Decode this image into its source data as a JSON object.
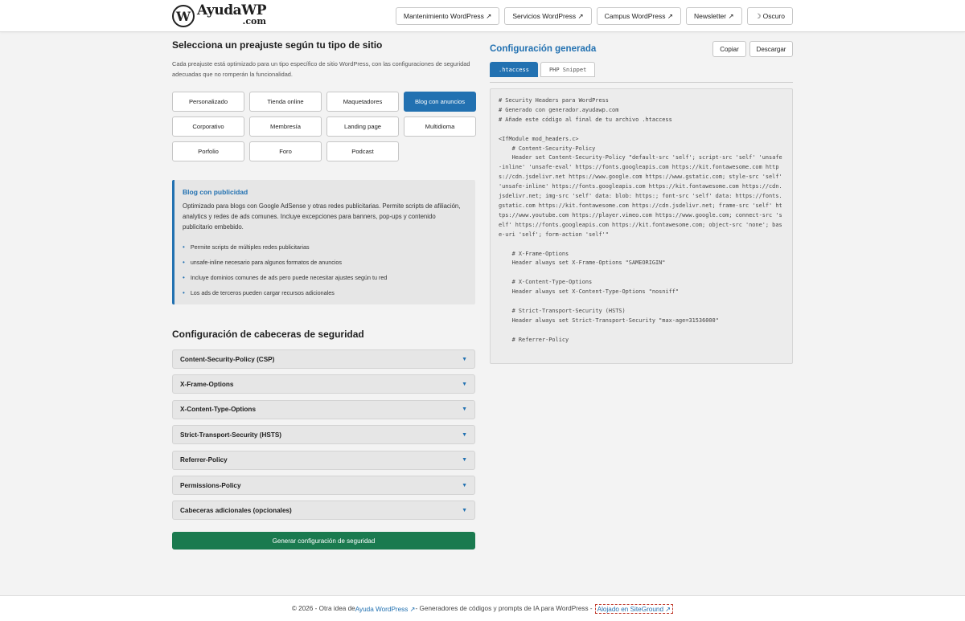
{
  "header": {
    "logo_mark": "W",
    "logo_line1": "AyudaWP",
    "logo_line2": ".com",
    "nav": [
      {
        "label": "Mantenimiento WordPress ↗"
      },
      {
        "label": "Servicios WordPress ↗"
      },
      {
        "label": "Campus WordPress ↗"
      },
      {
        "label": "Newsletter ↗"
      },
      {
        "label": "☽ Oscuro"
      }
    ]
  },
  "presets": {
    "title": "Selecciona un preajuste según tu tipo de sitio",
    "description": "Cada preajuste está optimizado para un tipo específico de sitio WordPress, con las configuraciones de seguridad adecuadas que no romperán la funcionalidad.",
    "items": [
      {
        "label": "Personalizado",
        "active": false
      },
      {
        "label": "Tienda online",
        "active": false
      },
      {
        "label": "Maquetadores",
        "active": false
      },
      {
        "label": "Blog con anuncios",
        "active": true
      },
      {
        "label": "Corporativo",
        "active": false
      },
      {
        "label": "Membresía",
        "active": false
      },
      {
        "label": "Landing page",
        "active": false
      },
      {
        "label": "Multidioma",
        "active": false
      },
      {
        "label": "Porfolio",
        "active": false
      },
      {
        "label": "Foro",
        "active": false
      },
      {
        "label": "Podcast",
        "active": false
      }
    ]
  },
  "info": {
    "title": "Blog con publicidad",
    "description": "Optimizado para blogs con Google AdSense y otras redes publicitarias. Permite scripts de afiliación, analytics y redes de ads comunes. Incluye excepciones para banners, pop-ups y contenido publicitario embebido.",
    "bullets": [
      "Permite scripts de múltiples redes publicitarias",
      "unsafe-inline necesario para algunos formatos de anuncios",
      "Incluye dominios comunes de ads pero puede necesitar ajustes según tu red",
      "Los ads de terceros pueden cargar recursos adicionales"
    ]
  },
  "headers_config": {
    "title": "Configuración de cabeceras de seguridad",
    "items": [
      "Content-Security-Policy (CSP)",
      "X-Frame-Options",
      "X-Content-Type-Options",
      "Strict-Transport-Security (HSTS)",
      "Referrer-Policy",
      "Permissions-Policy",
      "Cabeceras adicionales (opcionales)"
    ],
    "arrow": "▼",
    "generate_label": "Generar configuración de seguridad"
  },
  "output": {
    "title": "Configuración generada",
    "copy_label": "Copiar",
    "download_label": "Descargar",
    "tabs": [
      {
        "label": ".htaccess",
        "active": true
      },
      {
        "label": "PHP Snippet",
        "active": false
      }
    ],
    "code": "# Security Headers para WordPress\n# Generado con generador.ayudawp.com\n# Añade este código al final de tu archivo .htaccess\n\n<IfModule mod_headers.c>\n    # Content-Security-Policy\n    Header set Content-Security-Policy \"default-src 'self'; script-src 'self' 'unsafe-inline' 'unsafe-eval' https://fonts.googleapis.com https://kit.fontawesome.com https://cdn.jsdelivr.net https://www.google.com https://www.gstatic.com; style-src 'self' 'unsafe-inline' https://fonts.googleapis.com https://kit.fontawesome.com https://cdn.jsdelivr.net; img-src 'self' data: blob: https:; font-src 'self' data: https://fonts.gstatic.com https://kit.fontawesome.com https://cdn.jsdelivr.net; frame-src 'self' https://www.youtube.com https://player.vimeo.com https://www.google.com; connect-src 'self' https://fonts.googleapis.com https://kit.fontawesome.com; object-src 'none'; base-uri 'self'; form-action 'self'\"\n\n    # X-Frame-Options\n    Header always set X-Frame-Options \"SAMEORIGIN\"\n\n    # X-Content-Type-Options\n    Header always set X-Content-Type-Options \"nosniff\"\n\n    # Strict-Transport-Security (HSTS)\n    Header always set Strict-Transport-Security \"max-age=31536000\"\n\n    # Referrer-Policy"
  },
  "footer": {
    "prefix": "© 2026 - Otra idea de ",
    "link1": "Ayuda WordPress ↗",
    "middle": " - Generadores de códigos y prompts de IA para WordPress - ",
    "link2": "Alojado en SiteGround ↗"
  }
}
